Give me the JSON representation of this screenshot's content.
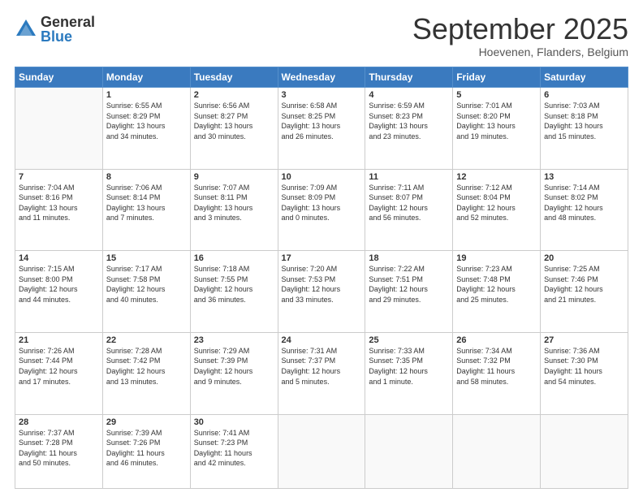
{
  "logo": {
    "general": "General",
    "blue": "Blue"
  },
  "header": {
    "month": "September 2025",
    "location": "Hoevenen, Flanders, Belgium"
  },
  "days": [
    "Sunday",
    "Monday",
    "Tuesday",
    "Wednesday",
    "Thursday",
    "Friday",
    "Saturday"
  ],
  "weeks": [
    [
      {
        "num": "",
        "info": ""
      },
      {
        "num": "1",
        "info": "Sunrise: 6:55 AM\nSunset: 8:29 PM\nDaylight: 13 hours\nand 34 minutes."
      },
      {
        "num": "2",
        "info": "Sunrise: 6:56 AM\nSunset: 8:27 PM\nDaylight: 13 hours\nand 30 minutes."
      },
      {
        "num": "3",
        "info": "Sunrise: 6:58 AM\nSunset: 8:25 PM\nDaylight: 13 hours\nand 26 minutes."
      },
      {
        "num": "4",
        "info": "Sunrise: 6:59 AM\nSunset: 8:23 PM\nDaylight: 13 hours\nand 23 minutes."
      },
      {
        "num": "5",
        "info": "Sunrise: 7:01 AM\nSunset: 8:20 PM\nDaylight: 13 hours\nand 19 minutes."
      },
      {
        "num": "6",
        "info": "Sunrise: 7:03 AM\nSunset: 8:18 PM\nDaylight: 13 hours\nand 15 minutes."
      }
    ],
    [
      {
        "num": "7",
        "info": "Sunrise: 7:04 AM\nSunset: 8:16 PM\nDaylight: 13 hours\nand 11 minutes."
      },
      {
        "num": "8",
        "info": "Sunrise: 7:06 AM\nSunset: 8:14 PM\nDaylight: 13 hours\nand 7 minutes."
      },
      {
        "num": "9",
        "info": "Sunrise: 7:07 AM\nSunset: 8:11 PM\nDaylight: 13 hours\nand 3 minutes."
      },
      {
        "num": "10",
        "info": "Sunrise: 7:09 AM\nSunset: 8:09 PM\nDaylight: 13 hours\nand 0 minutes."
      },
      {
        "num": "11",
        "info": "Sunrise: 7:11 AM\nSunset: 8:07 PM\nDaylight: 12 hours\nand 56 minutes."
      },
      {
        "num": "12",
        "info": "Sunrise: 7:12 AM\nSunset: 8:04 PM\nDaylight: 12 hours\nand 52 minutes."
      },
      {
        "num": "13",
        "info": "Sunrise: 7:14 AM\nSunset: 8:02 PM\nDaylight: 12 hours\nand 48 minutes."
      }
    ],
    [
      {
        "num": "14",
        "info": "Sunrise: 7:15 AM\nSunset: 8:00 PM\nDaylight: 12 hours\nand 44 minutes."
      },
      {
        "num": "15",
        "info": "Sunrise: 7:17 AM\nSunset: 7:58 PM\nDaylight: 12 hours\nand 40 minutes."
      },
      {
        "num": "16",
        "info": "Sunrise: 7:18 AM\nSunset: 7:55 PM\nDaylight: 12 hours\nand 36 minutes."
      },
      {
        "num": "17",
        "info": "Sunrise: 7:20 AM\nSunset: 7:53 PM\nDaylight: 12 hours\nand 33 minutes."
      },
      {
        "num": "18",
        "info": "Sunrise: 7:22 AM\nSunset: 7:51 PM\nDaylight: 12 hours\nand 29 minutes."
      },
      {
        "num": "19",
        "info": "Sunrise: 7:23 AM\nSunset: 7:48 PM\nDaylight: 12 hours\nand 25 minutes."
      },
      {
        "num": "20",
        "info": "Sunrise: 7:25 AM\nSunset: 7:46 PM\nDaylight: 12 hours\nand 21 minutes."
      }
    ],
    [
      {
        "num": "21",
        "info": "Sunrise: 7:26 AM\nSunset: 7:44 PM\nDaylight: 12 hours\nand 17 minutes."
      },
      {
        "num": "22",
        "info": "Sunrise: 7:28 AM\nSunset: 7:42 PM\nDaylight: 12 hours\nand 13 minutes."
      },
      {
        "num": "23",
        "info": "Sunrise: 7:29 AM\nSunset: 7:39 PM\nDaylight: 12 hours\nand 9 minutes."
      },
      {
        "num": "24",
        "info": "Sunrise: 7:31 AM\nSunset: 7:37 PM\nDaylight: 12 hours\nand 5 minutes."
      },
      {
        "num": "25",
        "info": "Sunrise: 7:33 AM\nSunset: 7:35 PM\nDaylight: 12 hours\nand 1 minute."
      },
      {
        "num": "26",
        "info": "Sunrise: 7:34 AM\nSunset: 7:32 PM\nDaylight: 11 hours\nand 58 minutes."
      },
      {
        "num": "27",
        "info": "Sunrise: 7:36 AM\nSunset: 7:30 PM\nDaylight: 11 hours\nand 54 minutes."
      }
    ],
    [
      {
        "num": "28",
        "info": "Sunrise: 7:37 AM\nSunset: 7:28 PM\nDaylight: 11 hours\nand 50 minutes."
      },
      {
        "num": "29",
        "info": "Sunrise: 7:39 AM\nSunset: 7:26 PM\nDaylight: 11 hours\nand 46 minutes."
      },
      {
        "num": "30",
        "info": "Sunrise: 7:41 AM\nSunset: 7:23 PM\nDaylight: 11 hours\nand 42 minutes."
      },
      {
        "num": "",
        "info": ""
      },
      {
        "num": "",
        "info": ""
      },
      {
        "num": "",
        "info": ""
      },
      {
        "num": "",
        "info": ""
      }
    ]
  ]
}
